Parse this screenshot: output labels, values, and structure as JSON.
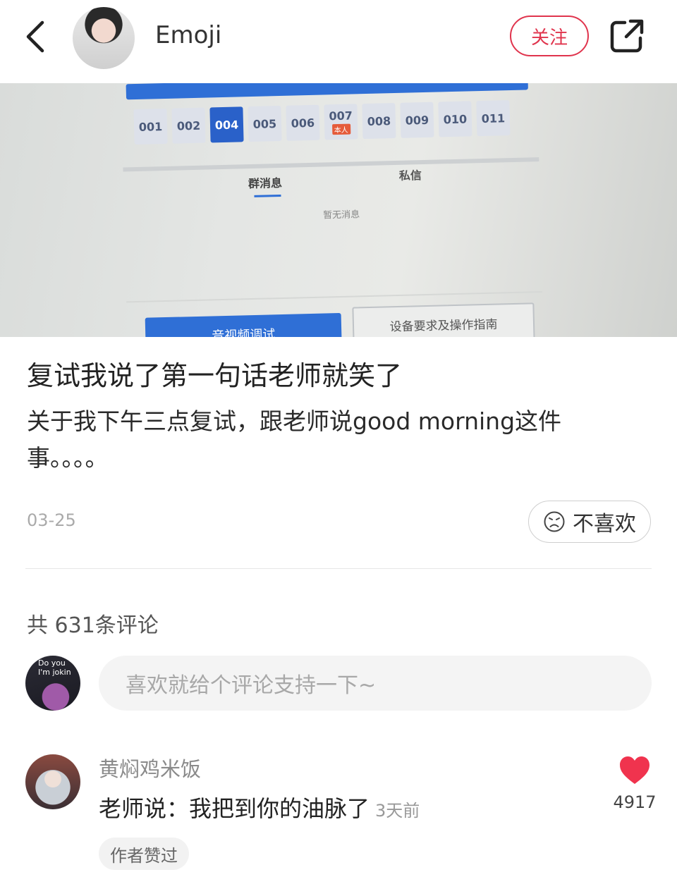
{
  "header": {
    "author_name": "Emoji",
    "follow_label": "关注"
  },
  "photo": {
    "seats": [
      {
        "label": "001",
        "active": false,
        "tag": ""
      },
      {
        "label": "002",
        "active": false,
        "tag": ""
      },
      {
        "label": "004",
        "active": true,
        "tag": ""
      },
      {
        "label": "005",
        "active": false,
        "tag": ""
      },
      {
        "label": "006",
        "active": false,
        "tag": ""
      },
      {
        "label": "007",
        "active": false,
        "tag": "本人"
      },
      {
        "label": "008",
        "active": false,
        "tag": ""
      },
      {
        "label": "009",
        "active": false,
        "tag": ""
      },
      {
        "label": "010",
        "active": false,
        "tag": ""
      },
      {
        "label": "011",
        "active": false,
        "tag": ""
      }
    ],
    "tab_group": "群消息",
    "tab_private": "私信",
    "empty_message": "暂无消息",
    "button_av": "音视频调试",
    "button_guide": "设备要求及操作指南"
  },
  "post": {
    "title": "复试我说了第一句话老师就笑了",
    "body": "关于我下午三点复试，跟老师说good morning这件事。。。。",
    "date": "03-25",
    "dislike_label": "不喜欢"
  },
  "comments": {
    "count_label": "共 631条评论",
    "input_placeholder": "喜欢就给个评论支持一下~",
    "my_avatar_text": "Do you\nI'm jokin",
    "items": [
      {
        "user": "黄焖鸡米饭",
        "text": "老师说：我把到你的油脉了",
        "time": "3天前",
        "likes": "4917",
        "badge": "作者赞过"
      }
    ]
  },
  "colors": {
    "accent": "#e0344d",
    "like": "#f0334e"
  }
}
